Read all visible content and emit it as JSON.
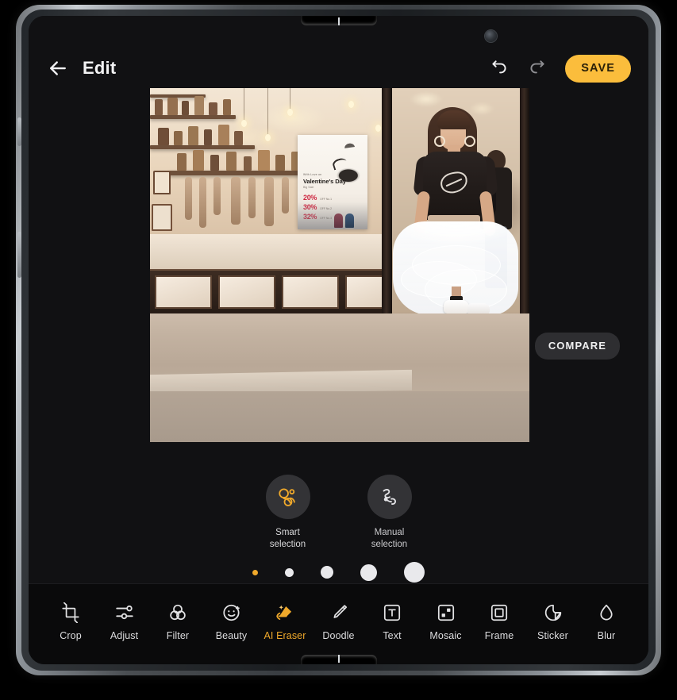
{
  "app": {
    "title": "Edit",
    "device": "foldable-tablet"
  },
  "header": {
    "back_icon": "back-arrow-icon",
    "title": "Edit",
    "undo_icon": "undo-icon",
    "redo_icon": "redo-icon",
    "save_label": "SAVE",
    "save_color": "#fbbd3c"
  },
  "canvas": {
    "compare_label": "COMPARE",
    "photo_alt": "Woman in black graphic tee and white tulle skirt standing in a shop doorway",
    "poster": {
      "headline": "With Love on",
      "title": "Valentine's Day",
      "subtitle": "Big Sale",
      "rows": [
        {
          "pct": "20%",
          "note": "OFF No.1"
        },
        {
          "pct": "30%",
          "note": "OFF No.2"
        },
        {
          "pct": "32%",
          "note": "OFF No.3"
        }
      ]
    }
  },
  "selection": {
    "modes": [
      {
        "label": "Smart\nselection",
        "icon": "smart-selection-icon",
        "active": true
      },
      {
        "label": "Manual\nselection",
        "icon": "manual-selection-icon",
        "active": false
      }
    ],
    "brush_sizes": [
      {
        "size": 7,
        "active": true
      },
      {
        "size": 11,
        "active": false
      },
      {
        "size": 16,
        "active": false
      },
      {
        "size": 21,
        "active": false
      },
      {
        "size": 26,
        "active": false
      }
    ],
    "active_color": "#f0a92b"
  },
  "toolbar": {
    "active_color": "#f0a92b",
    "tools": [
      {
        "label": "Crop",
        "icon": "crop-icon",
        "active": false
      },
      {
        "label": "Adjust",
        "icon": "adjust-icon",
        "active": false
      },
      {
        "label": "Filter",
        "icon": "filter-icon",
        "active": false
      },
      {
        "label": "Beauty",
        "icon": "beauty-icon",
        "active": false
      },
      {
        "label": "AI Eraser",
        "icon": "ai-eraser-icon",
        "active": true
      },
      {
        "label": "Doodle",
        "icon": "doodle-icon",
        "active": false
      },
      {
        "label": "Text",
        "icon": "text-icon",
        "active": false
      },
      {
        "label": "Mosaic",
        "icon": "mosaic-icon",
        "active": false
      },
      {
        "label": "Frame",
        "icon": "frame-icon",
        "active": false
      },
      {
        "label": "Sticker",
        "icon": "sticker-icon",
        "active": false
      },
      {
        "label": "Blur",
        "icon": "blur-icon",
        "active": false
      }
    ]
  }
}
